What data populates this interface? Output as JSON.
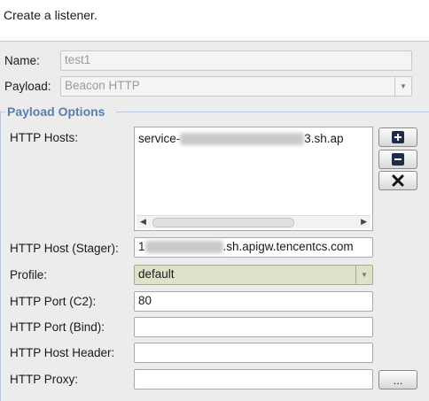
{
  "header": {
    "title": "Create a listener."
  },
  "form": {
    "name_label": "Name:",
    "name_value": "test1",
    "payload_label": "Payload:",
    "payload_value": "Beacon HTTP"
  },
  "payload_options": {
    "title": "Payload Options",
    "http_hosts_label": "HTTP Hosts:",
    "http_hosts_value_prefix": "service-",
    "http_hosts_value_suffix": "3.sh.ap",
    "stager_label": "HTTP Host (Stager):",
    "stager_value_prefix": "1",
    "stager_value_suffix": ".sh.apigw.tencentcs.com",
    "profile_label": "Profile:",
    "profile_value": "default",
    "port_c2_label": "HTTP Port (C2):",
    "port_c2_value": "80",
    "port_bind_label": "HTTP Port (Bind):",
    "port_bind_value": "",
    "host_header_label": "HTTP Host Header:",
    "host_header_value": "",
    "proxy_label": "HTTP Proxy:",
    "proxy_value": "",
    "proxy_button_label": "..."
  },
  "icons": {
    "add": "plus-icon",
    "remove": "minus-icon",
    "clear": "x-icon"
  }
}
